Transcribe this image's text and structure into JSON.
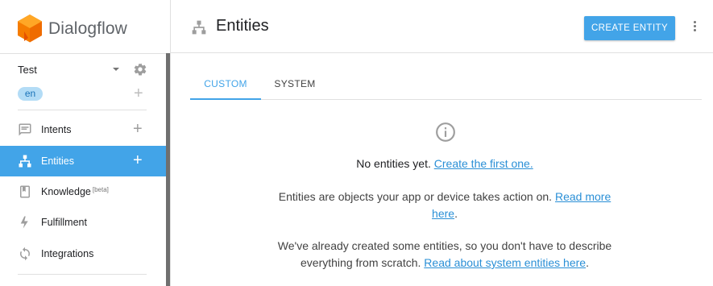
{
  "brand": {
    "name": "Dialogflow",
    "logo_icon": "dialogflow-logo-icon",
    "logo_color": "#f57c00"
  },
  "agent": {
    "name": "Test",
    "caret_icon": "caret-down-icon",
    "settings_icon": "gear-icon"
  },
  "language": {
    "code": "en",
    "add_icon": "plus-icon"
  },
  "sidebar": {
    "items": [
      {
        "label": "Intents",
        "icon": "chat-bubble-icon",
        "add": "+"
      },
      {
        "label": "Entities",
        "icon": "hierarchy-icon",
        "add": "+",
        "active": true
      },
      {
        "label": "Knowledge",
        "badge": "[beta]",
        "icon": "book-icon"
      },
      {
        "label": "Fulfillment",
        "icon": "lightning-icon"
      },
      {
        "label": "Integrations",
        "icon": "sync-icon"
      }
    ]
  },
  "header": {
    "title": "Entities",
    "icon": "hierarchy-icon",
    "create_button": "CREATE ENTITY",
    "menu_icon": "more-vert-icon"
  },
  "tabs": [
    {
      "label": "CUSTOM",
      "selected": true
    },
    {
      "label": "SYSTEM",
      "selected": false
    }
  ],
  "empty_state": {
    "icon": "info-icon",
    "line1_text": "No entities yet.",
    "line1_link": "Create the first one.",
    "line2_text": "Entities are objects your app or device takes action on.",
    "line2_link_a": "Read more",
    "line2_link_b": "here",
    "line2_end": ".",
    "line3_text_a": "We've already created some entities, so you don't have to describe",
    "line3_text_b": "everything from scratch.",
    "line3_link": "Read about system entities here",
    "line3_end": "."
  },
  "colors": {
    "accent": "#42a4e8",
    "link": "#2a8fd6",
    "lang_pill": "#b3dcf6"
  }
}
